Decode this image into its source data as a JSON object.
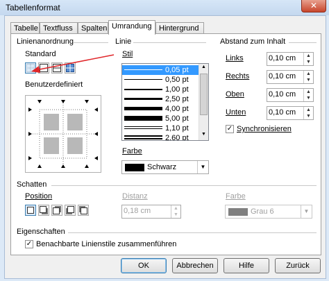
{
  "window": {
    "title": "Tabellenformat",
    "close_glyph": "✕"
  },
  "tabs": [
    {
      "label": "Tabelle",
      "active": false
    },
    {
      "label": "Textfluss",
      "active": false
    },
    {
      "label": "Spalten",
      "active": false
    },
    {
      "label": "Umrandung",
      "active": true
    },
    {
      "label": "Hintergrund",
      "active": false
    }
  ],
  "linienanordnung": {
    "heading": "Linienanordnung",
    "standard_label": "Standard",
    "benutzerdefiniert_label": "Benutzerdefiniert",
    "presets": [
      "border-none-icon",
      "border-outer-icon",
      "border-outer-horizontal-icon",
      "border-all-icon"
    ]
  },
  "linie": {
    "heading": "Linie",
    "stil_label": "Stil",
    "styles": [
      "0,05 pt",
      "0,50 pt",
      "1,00 pt",
      "2,50 pt",
      "4,00 pt",
      "5,00 pt",
      "1,10 pt",
      "2,60 pt"
    ],
    "selected": "0,05 pt",
    "farbe_label": "Farbe",
    "farbe_value": "Schwarz",
    "farbe_color": "#000000"
  },
  "abstand": {
    "heading": "Abstand zum Inhalt",
    "links_label": "Links",
    "links_value": "0,10 cm",
    "rechts_label": "Rechts",
    "rechts_value": "0,10 cm",
    "oben_label": "Oben",
    "oben_value": "0,10 cm",
    "unten_label": "Unten",
    "unten_value": "0,10 cm",
    "sync_label": "Synchronisieren",
    "sync_checked": true
  },
  "schatten": {
    "heading": "Schatten",
    "position_label": "Position",
    "distanz_label": "Distanz",
    "distanz_value": "0,18 cm",
    "farbe_label": "Farbe",
    "farbe_value": "Grau 6",
    "farbe_color": "#808080"
  },
  "eigenschaften": {
    "heading": "Eigenschaften",
    "merge_label": "Benachbarte Linienstile zusammenführen",
    "merge_checked": true
  },
  "buttons": {
    "ok": "OK",
    "abbrechen": "Abbrechen",
    "hilfe": "Hilfe",
    "zurueck": "Zurück"
  },
  "colors": {
    "selection": "#3399ff",
    "annotation_arrow": "#e0262a"
  }
}
